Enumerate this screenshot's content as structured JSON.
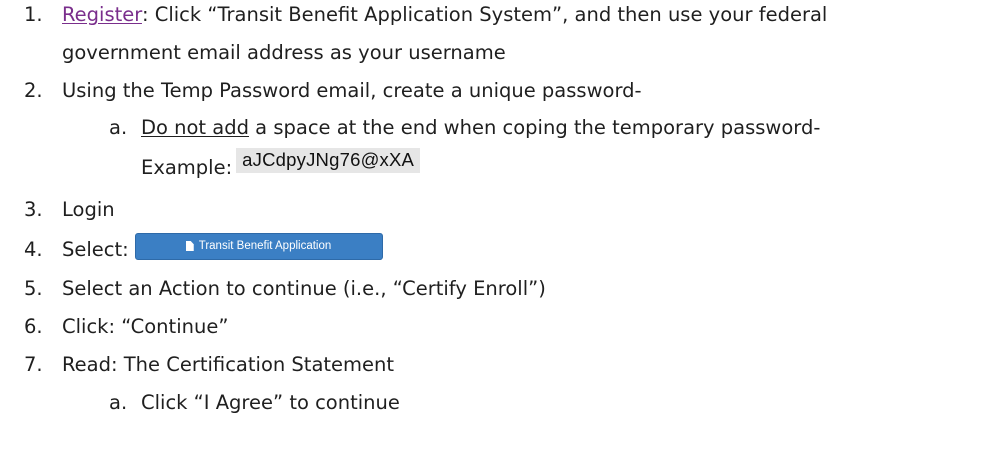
{
  "steps": [
    {
      "number": "1.",
      "link_text": "Register",
      "text_line1": ": Click “Transit Benefit Application System”, and then use your federal",
      "text_line2": "government email address as your username"
    },
    {
      "number": "2.",
      "text": "Using the Temp Password email, create a unique password-",
      "sub": {
        "letter": "a.",
        "underlined": "Do not add",
        "text": " a space at the end  when coping the temporary password-",
        "example_label": "Example:",
        "example_value": "aJCdpyJNg76@xXA"
      }
    },
    {
      "number": "3.",
      "text": "Login"
    },
    {
      "number": "4.",
      "text": "Select:",
      "button_label": "Transit Benefit Application",
      "button_icon": "file-icon"
    },
    {
      "number": "5.",
      "text": "Select an Action to continue (i.e., “Certify Enroll”)"
    },
    {
      "number": "6.",
      "text": "Click: “Continue”"
    },
    {
      "number": "7.",
      "text": "Read: The Certification Statement",
      "sub": {
        "letter": "a.",
        "text": "Click “I Agree” to continue"
      }
    }
  ],
  "colors": {
    "link": "#7a2e8c",
    "button": "#3b7fc4",
    "text": "#1f1f1f"
  }
}
